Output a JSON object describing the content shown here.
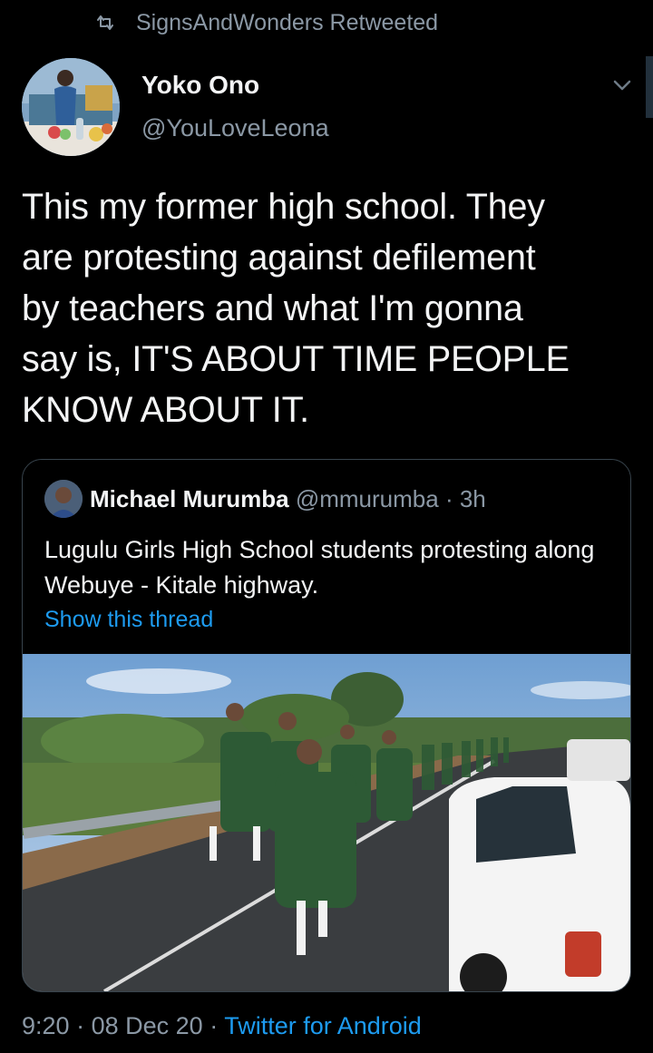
{
  "retweet": {
    "icon": "retweet-icon",
    "text": "SignsAndWonders Retweeted"
  },
  "tweet": {
    "author_name": "Yoko Ono",
    "author_handle": "@YouLoveLeona",
    "text": "This my former high school. They\nare protesting against defilement\nby teachers and what I'm gonna\nsay is, IT'S ABOUT TIME PEOPLE\nKNOW ABOUT IT."
  },
  "quote": {
    "author_name": "Michael Murumba",
    "author_handle": "@mmurumba",
    "separator": "·",
    "time": "3h",
    "text": "Lugulu Girls High School students protesting along Webuye - Kitale highway.",
    "show_thread": "Show this thread"
  },
  "footer": {
    "time": "9:20",
    "separator": "·",
    "date": "08 Dec 20",
    "source": "Twitter for Android"
  },
  "colors": {
    "background": "#000000",
    "accent": "#1d9bf0",
    "muted": "#8b98a5"
  }
}
